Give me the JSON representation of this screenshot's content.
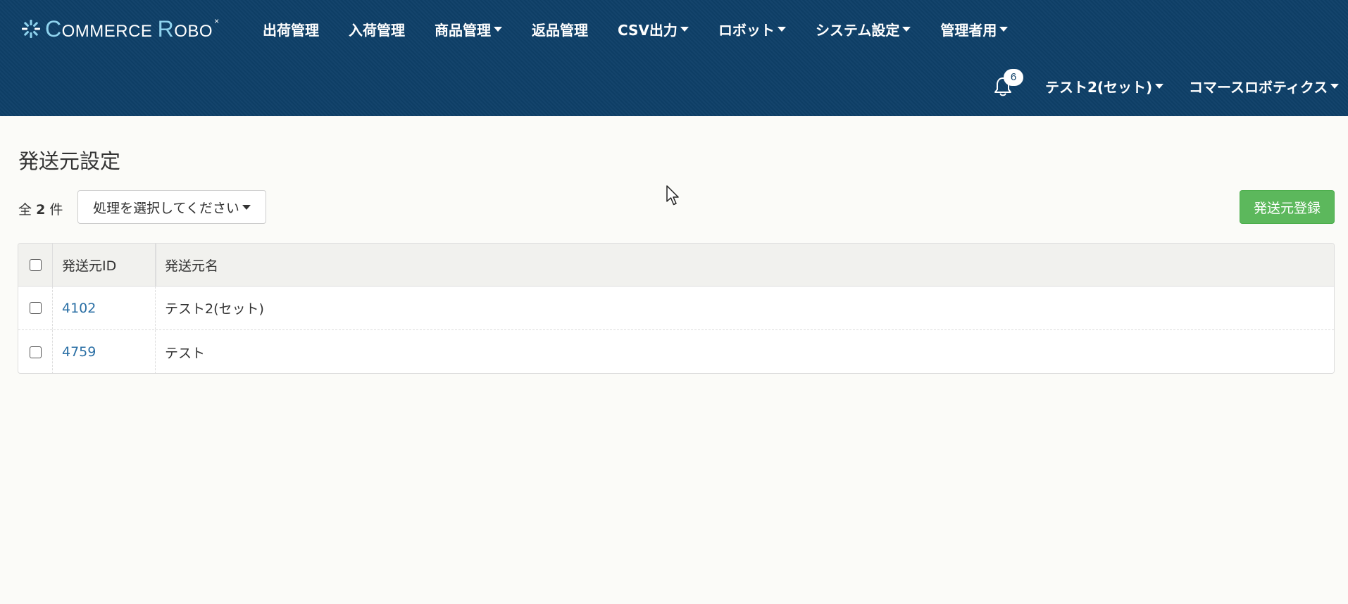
{
  "header": {
    "logo": {
      "part1_big": "C",
      "part1": "OMMERCE ",
      "part2_big": "R",
      "part2": "OBO",
      "superscript": "×"
    },
    "menu": [
      {
        "label": "出荷管理",
        "dropdown": false
      },
      {
        "label": "入荷管理",
        "dropdown": false
      },
      {
        "label": "商品管理",
        "dropdown": true
      },
      {
        "label": "返品管理",
        "dropdown": false
      },
      {
        "label": "CSV出力",
        "dropdown": true
      },
      {
        "label": "ロボット",
        "dropdown": true
      },
      {
        "label": "システム設定",
        "dropdown": true
      },
      {
        "label": "管理者用",
        "dropdown": true
      }
    ],
    "notifications": {
      "icon": "bell-icon",
      "count": "6"
    },
    "shop_menu": "テスト2(セット)",
    "company_menu": "コマースロボティクス"
  },
  "page": {
    "title": "発送元設定",
    "count": {
      "prefix": "全",
      "value": "2",
      "suffix": "件"
    },
    "action_select": "処理を選択してください",
    "register_button": "発送元登録"
  },
  "table": {
    "headers": {
      "id": "発送元ID",
      "name": "発送元名"
    },
    "rows": [
      {
        "id": "4102",
        "name": "テスト2(セット)"
      },
      {
        "id": "4759",
        "name": "テスト"
      }
    ]
  },
  "colors": {
    "navbar": "#0e4068",
    "link": "#2a6fa5",
    "primary_button": "#5cb85c",
    "background": "#fbfbf8"
  }
}
